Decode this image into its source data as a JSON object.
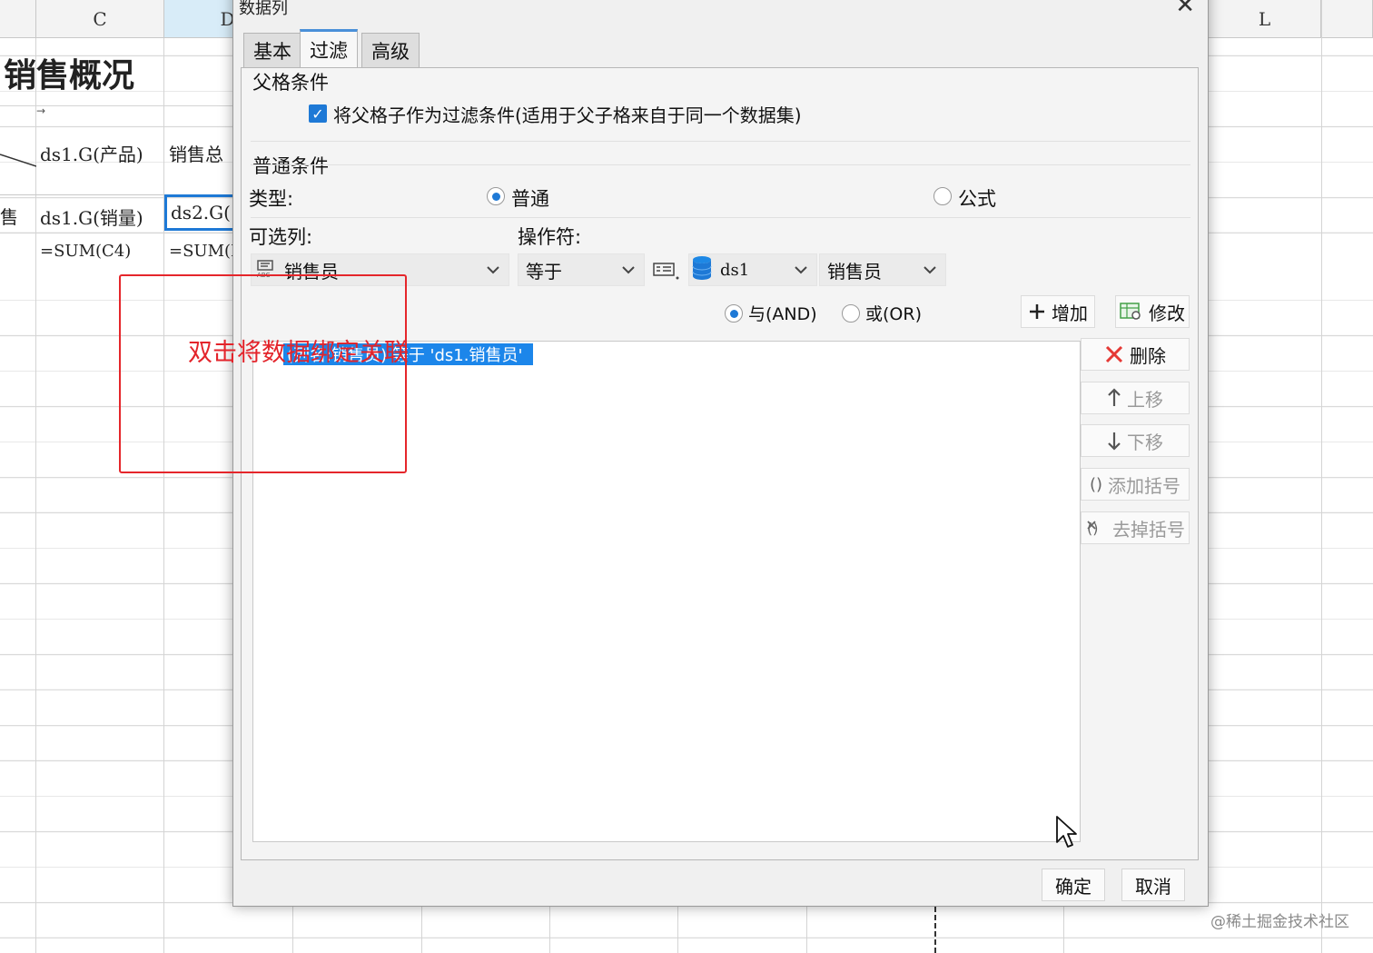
{
  "sheet": {
    "col_headers": {
      "c": "C",
      "d": "D",
      "l": "L"
    },
    "title": "销售概况",
    "cells": {
      "c3": "ds1.G(产品)",
      "d3": "销售总",
      "b4": "售",
      "c4": "ds1.G(销量)",
      "d4": "ds2.G(",
      "c5": "=SUM(C4)",
      "d5": "=SUM(D"
    }
  },
  "annotation": {
    "text": "双击将数据绑定关联"
  },
  "dialog": {
    "title": "数据列",
    "tabs": [
      {
        "label": "基本",
        "active": false
      },
      {
        "label": "过滤",
        "active": true
      },
      {
        "label": "高级",
        "active": false
      }
    ],
    "parent_condition": {
      "section_label": "父格条件",
      "checkbox_label": "将父格子作为过滤条件(适用于父子格来自于同一个数据集)",
      "checked": true
    },
    "normal_condition": {
      "section_label": "普通条件",
      "type_label": "类型:",
      "type_options": [
        {
          "label": "普通",
          "selected": true
        },
        {
          "label": "公式",
          "selected": false
        }
      ],
      "column_label": "可选列:",
      "operator_label": "操作符:",
      "column_value": "销售员",
      "operator_value": "等于",
      "dataset_value": "ds1",
      "field_value": "销售员",
      "logic_options": [
        {
          "label": "与(AND)",
          "selected": true
        },
        {
          "label": "或(OR)",
          "selected": false
        }
      ],
      "add_button": "增加",
      "modify_button": "修改",
      "delete_button": "删除",
      "up_button": "上移",
      "down_button": "下移",
      "add_bracket_button": "添加括号",
      "remove_bracket_button": "去掉括号",
      "conditions": [
        "(列名:销售员) 等于 'ds1.销售员'"
      ]
    },
    "ok_button": "确定",
    "cancel_button": "取消"
  },
  "watermark": "@稀土掘金技术社区",
  "colors": {
    "accent": "#1e79d6",
    "selection": "#1c86ea",
    "annotation": "#e5262b",
    "delete_icon": "#e53935"
  }
}
